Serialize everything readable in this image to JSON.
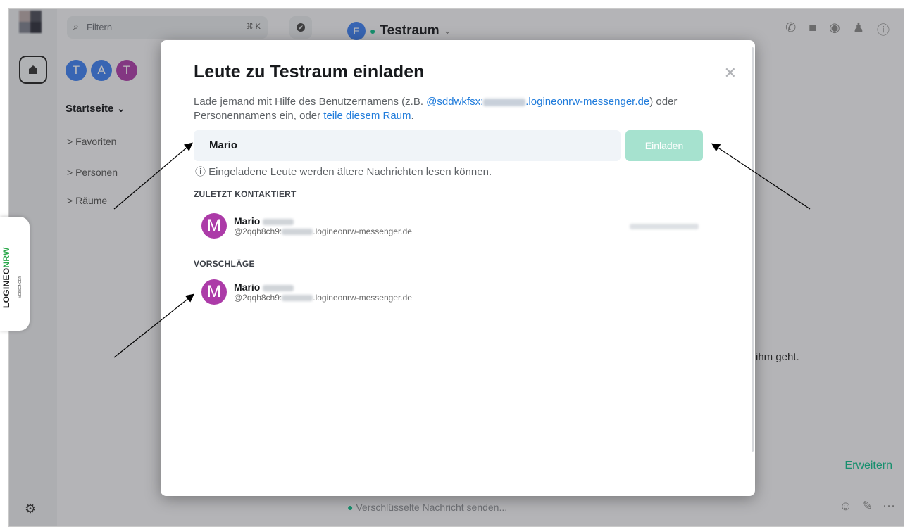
{
  "spaces": {
    "settings_icon": "gear-icon"
  },
  "roomlist": {
    "filter_placeholder": "Filtern",
    "filter_shortcut": "⌘ K",
    "space_avatars": [
      {
        "letter": "T",
        "color": "#3d7ff0"
      },
      {
        "letter": "A",
        "color": "#3d7ff0"
      },
      {
        "letter": "T",
        "color": "#ac3ba8"
      }
    ],
    "home_title": "Startseite ⌄",
    "sections": [
      "> Favoriten",
      "> Personen",
      "> Räume"
    ]
  },
  "room": {
    "avatar_letter": "E",
    "name": "Testraum",
    "name_suffix": "⌄",
    "partial_message": "ihm geht.",
    "expand_label": "Erweitern",
    "composer_placeholder": "Verschlüsselte Nachricht senden..."
  },
  "badge": {
    "brand": "LOGINEO",
    "brand_accent": "NRW",
    "sub": "MESSENGER"
  },
  "dialog": {
    "title": "Leute zu Testraum einladen",
    "description_prefix": "Lade jemand mit Hilfe des Benutzernamens (z.B. ",
    "description_example_start": "@sddwkfsx:",
    "description_example_end": ".logineonrw-messenger.de",
    "description_mid": ") oder Personennamens ein, oder ",
    "description_link": "teile diesem Raum",
    "description_end": ".",
    "input_value": "Mario",
    "invite_button": "Einladen",
    "note": "ⓘ Eingeladene Leute werden ältere Nachrichten lesen können.",
    "recent_label": "ZULETZT KONTAKTIERT",
    "suggestions_label": "VORSCHLÄGE",
    "recent": [
      {
        "avatar": "M",
        "name": "Mario",
        "id_prefix": "@2qqb8ch9:",
        "id_suffix": ".logineonrw-messenger.de"
      }
    ],
    "suggestions": [
      {
        "avatar": "M",
        "name": "Mario",
        "id_prefix": "@2qqb8ch9:",
        "id_suffix": ".logineonrw-messenger.de"
      }
    ]
  },
  "colors": {
    "accent": "#0dbd8b",
    "invite_disabled": "#a6e2cf",
    "link": "#1f7bdb",
    "user_avatar": "#ac3ba8"
  }
}
